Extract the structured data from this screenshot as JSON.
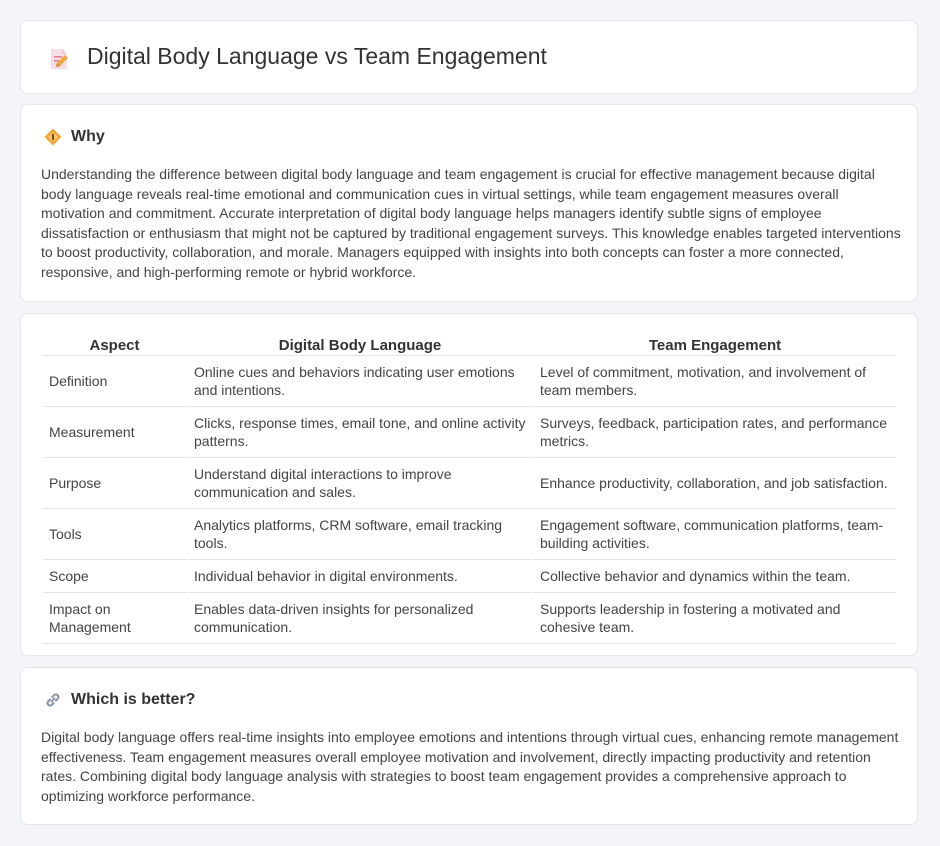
{
  "page": {
    "title": "Digital Body Language vs Team Engagement",
    "title_icon": "document-pencil-icon"
  },
  "why": {
    "heading": "Why",
    "icon": "diamond-sign-icon",
    "text": "Understanding the difference between digital body language and team engagement is crucial for effective management because digital body language reveals real-time emotional and communication cues in virtual settings, while team engagement measures overall motivation and commitment. Accurate interpretation of digital body language helps managers identify subtle signs of employee dissatisfaction or enthusiasm that might not be captured by traditional engagement surveys. This knowledge enables targeted interventions to boost productivity, collaboration, and morale. Managers equipped with insights into both concepts can foster a more connected, responsive, and high-performing remote or hybrid workforce."
  },
  "table": {
    "headers": [
      "Aspect",
      "Digital Body Language",
      "Team Engagement"
    ],
    "rows": [
      [
        "Definition",
        "Online cues and behaviors indicating user emotions and intentions.",
        "Level of commitment, motivation, and involvement of team members."
      ],
      [
        "Measurement",
        "Clicks, response times, email tone, and online activity patterns.",
        "Surveys, feedback, participation rates, and performance metrics."
      ],
      [
        "Purpose",
        "Understand digital interactions to improve communication and sales.",
        "Enhance productivity, collaboration, and job satisfaction."
      ],
      [
        "Tools",
        "Analytics platforms, CRM software, email tracking tools.",
        "Engagement software, communication platforms, team-building activities."
      ],
      [
        "Scope",
        "Individual behavior in digital environments.",
        "Collective behavior and dynamics within the team."
      ],
      [
        "Impact on Management",
        "Enables data-driven insights for personalized communication.",
        "Supports leadership in fostering a motivated and cohesive team."
      ]
    ]
  },
  "better": {
    "heading": "Which is better?",
    "icon": "link-icon",
    "text": "Digital body language offers real-time insights into employee emotions and intentions through virtual cues, enhancing remote management effectiveness. Team engagement measures overall employee motivation and involvement, directly impacting productivity and retention rates. Combining digital body language analysis with strategies to boost team engagement provides a comprehensive approach to optimizing workforce performance."
  },
  "colors": {
    "background": "#f3f5f8",
    "card": "#ffffff",
    "text": "#333333",
    "icon_orange": "#f0a63a",
    "icon_pink": "#e6829a"
  }
}
